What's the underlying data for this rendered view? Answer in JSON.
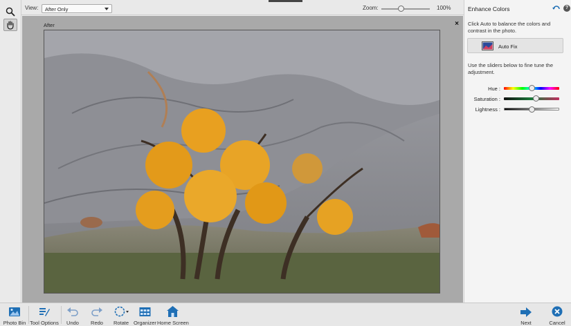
{
  "toolbar": {
    "view_label": "View:",
    "view_value": "After Only",
    "zoom_label": "Zoom:",
    "zoom_value": "100%",
    "zoom_fraction": 0.4
  },
  "tools": [
    {
      "name": "zoom-tool",
      "icon": "magnifier-icon"
    },
    {
      "name": "hand-tool",
      "icon": "hand-icon",
      "selected": true
    }
  ],
  "canvas": {
    "label": "After",
    "close_label": "×"
  },
  "panel": {
    "title": "Enhance Colors",
    "intro": "Click Auto to balance the colors and contrast in the photo.",
    "autofix_label": "Auto Fix",
    "hint": "Use the sliders below to fine tune the adjustment.",
    "help_label": "?",
    "sliders": [
      {
        "label": "Hue :",
        "value": 0.5
      },
      {
        "label": "Saturation :",
        "value": 0.58
      },
      {
        "label": "Lightness :",
        "value": 0.5
      }
    ]
  },
  "bottom": {
    "left_buttons": [
      {
        "label": "Photo Bin",
        "icon": "photo-bin-icon"
      },
      {
        "label": "Tool Options",
        "icon": "tool-options-icon"
      },
      {
        "label": "Undo",
        "icon": "undo-icon"
      },
      {
        "label": "Redo",
        "icon": "redo-icon"
      },
      {
        "label": "Rotate",
        "icon": "rotate-icon"
      },
      {
        "label": "Organizer",
        "icon": "organizer-icon"
      },
      {
        "label": "Home Screen",
        "icon": "home-icon"
      }
    ],
    "right_buttons": [
      {
        "label": "Next",
        "icon": "arrow-right-icon"
      },
      {
        "label": "Cancel",
        "icon": "cancel-icon"
      }
    ]
  },
  "colors": {
    "accent": "#1f6fb5",
    "foliage": "#e8a020",
    "slope": "#8c8d92"
  }
}
